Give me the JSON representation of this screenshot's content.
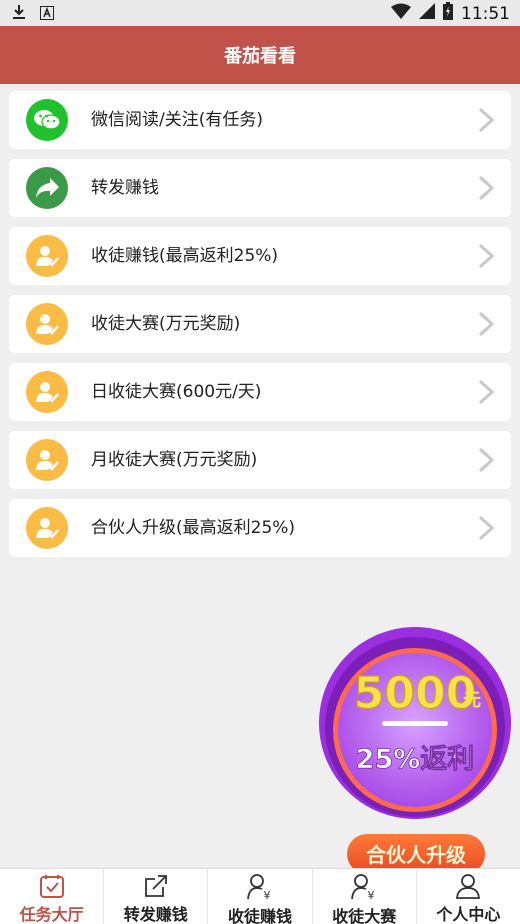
{
  "status_bar": {
    "time": "11:51"
  },
  "header": {
    "title": "番茄看看"
  },
  "tasks": [
    {
      "label": "微信阅读/关注(有任务)",
      "icon": "wechat-icon",
      "color": "#21c12e"
    },
    {
      "label": "转发赚钱",
      "icon": "share-icon",
      "color": "#3a9a48"
    },
    {
      "label": "收徒赚钱(最高返利25%)",
      "icon": "user-check-icon",
      "color": "#fbbc46"
    },
    {
      "label": "收徒大赛(万元奖励)",
      "icon": "user-check-icon",
      "color": "#fbbc46"
    },
    {
      "label": "日收徒大赛(600元/天)",
      "icon": "user-check-icon",
      "color": "#fbbc46"
    },
    {
      "label": "月收徒大赛(万元奖励)",
      "icon": "user-check-icon",
      "color": "#fbbc46"
    },
    {
      "label": "合伙人升级(最高返利25%)",
      "icon": "user-check-icon",
      "color": "#fbbc46"
    }
  ],
  "promo": {
    "amount": "5000",
    "unit": "元",
    "rebate": "25%返利",
    "button": "合伙人升级"
  },
  "tabs": [
    {
      "label": "任务大厅",
      "icon": "task-hall-icon",
      "active": true
    },
    {
      "label": "转发赚钱",
      "icon": "share-edit-icon",
      "active": false
    },
    {
      "label": "收徒赚钱",
      "icon": "user-yen-icon",
      "active": false
    },
    {
      "label": "收徒大赛",
      "icon": "user-yen-icon",
      "active": false
    },
    {
      "label": "个人中心",
      "icon": "user-icon",
      "active": false
    }
  ],
  "colors": {
    "accent": "#c0524a",
    "promo_purple": "#b35ef2",
    "promo_orange": "#f25c2a"
  }
}
